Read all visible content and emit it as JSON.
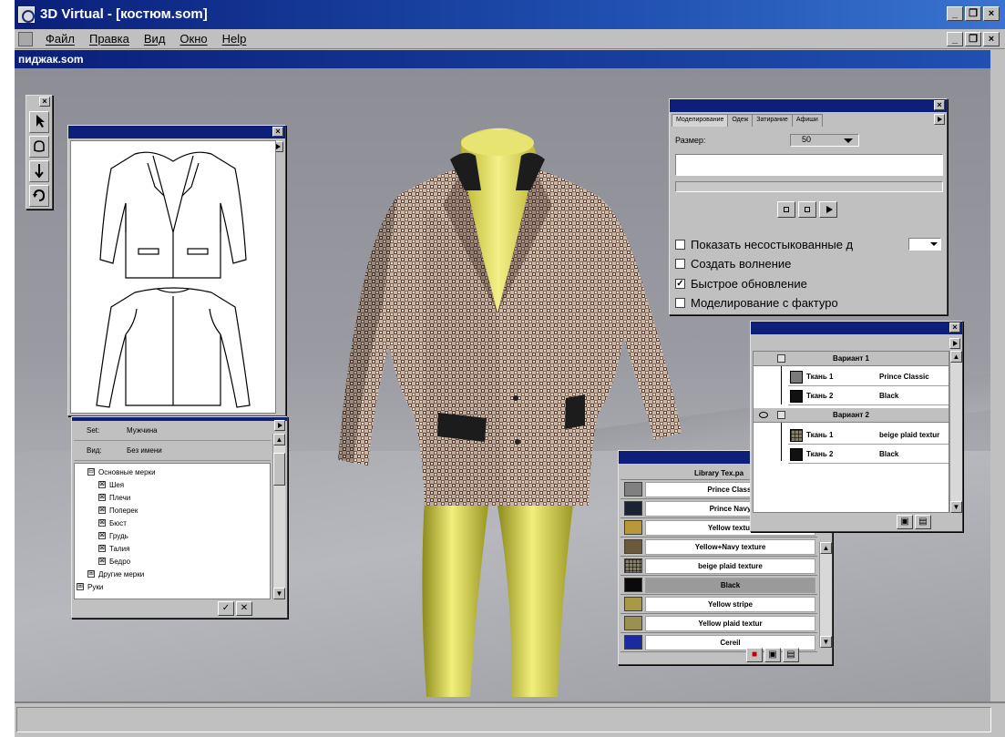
{
  "app": {
    "title": "3D Virtual - [костюм.som]",
    "doc_title": "пиджак.som"
  },
  "menu": {
    "items": [
      "Файл",
      "Правка",
      "Вид",
      "Окно",
      "Help"
    ]
  },
  "window_buttons": [
    "_",
    "❐",
    "×"
  ],
  "toolbox": {
    "tools": [
      "select-arrow-icon",
      "grab-hand-icon",
      "pin-icon",
      "rotate-icon"
    ]
  },
  "tree_panel": {
    "set_label": "Set:",
    "set_value": "Мужчина",
    "view_label": "Вид:",
    "view_value": "Без имени",
    "nodes": [
      {
        "box": "⊟",
        "label": "Основные мерки"
      },
      {
        "box": "⊠",
        "label": "Шея"
      },
      {
        "box": "⊠",
        "label": "Плечи"
      },
      {
        "box": "⊠",
        "label": "Поперек"
      },
      {
        "box": "⊠",
        "label": "Бюст"
      },
      {
        "box": "⊠",
        "label": "Грудь"
      },
      {
        "box": "⊠",
        "label": "Талия"
      },
      {
        "box": "⊠",
        "label": "Бедро"
      },
      {
        "box": "⊞",
        "label": "Другие мерки"
      },
      {
        "box": "⊞",
        "label": "Руки"
      }
    ]
  },
  "modelling_panel": {
    "tabs": [
      "Моделирование",
      "Одеж",
      "Затирание",
      "Афиши"
    ],
    "size_label": "Размер:",
    "size_value": "50",
    "checkboxes": [
      {
        "label": "Показать несостыкованные д",
        "checked": false
      },
      {
        "label": "Создать волнение",
        "checked": false
      },
      {
        "label": "Быстрое обновление",
        "checked": true
      },
      {
        "label": "Моделирование с фактуро",
        "checked": false
      }
    ]
  },
  "variants_panel": {
    "groups": [
      {
        "name": "Вариант 1",
        "rows": [
          {
            "fabric": "Ткань 1",
            "material": "Prince Classic",
            "color": "#7a7a7a"
          },
          {
            "fabric": "Ткань 2",
            "material": "Black",
            "color": "#111111"
          }
        ]
      },
      {
        "name": "Вариант 2",
        "rows": [
          {
            "fabric": "Ткань 1",
            "material": "beige plaid textur",
            "color": "plaid"
          },
          {
            "fabric": "Ткань 2",
            "material": "Black",
            "color": "#111111"
          }
        ]
      }
    ]
  },
  "library_panel": {
    "header": "Library Tex.pa",
    "items": [
      {
        "name": "Prince Classi",
        "color": "#808080"
      },
      {
        "name": "Prince Navy",
        "color": "#1a2233"
      },
      {
        "name": "Yellow textur",
        "color": "#b89838"
      },
      {
        "name": "Yellow+Navy texture",
        "color": "#6a5a3a"
      },
      {
        "name": "beige plaid texture",
        "color": "plaid"
      },
      {
        "name": "Black",
        "color": "#0a0a0a",
        "selected": true
      },
      {
        "name": "Yellow stripe",
        "color": "#a89848"
      },
      {
        "name": "Yellow plaid textur",
        "color": "#9a9050"
      },
      {
        "name": "Cereil",
        "color": "#1a2aa0"
      }
    ]
  }
}
